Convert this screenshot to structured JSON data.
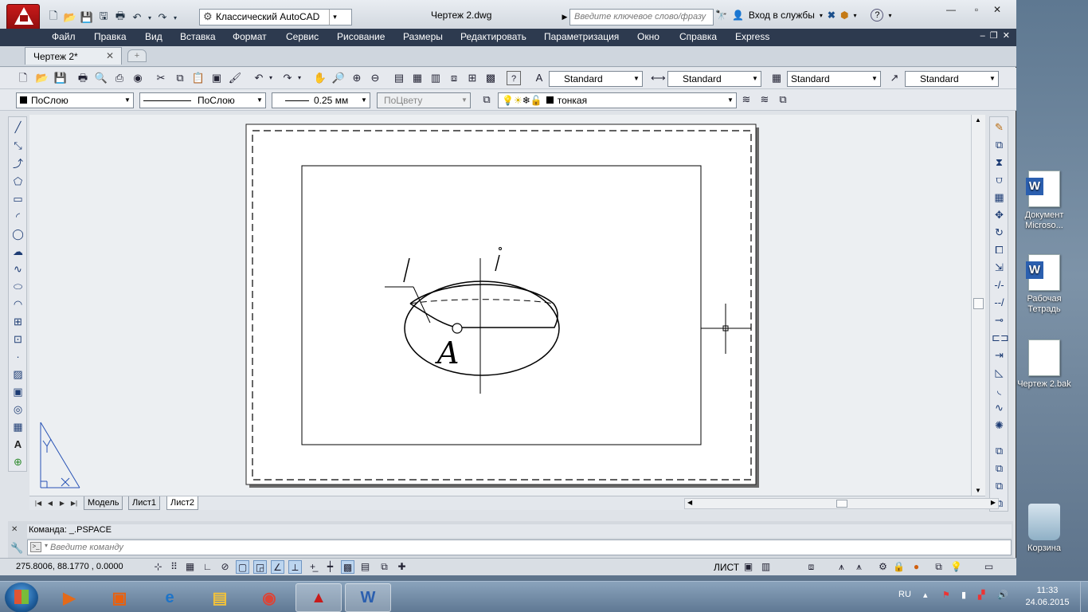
{
  "window": {
    "title": "Чертеж 2.dwg",
    "workspace": "Классический AutoCAD",
    "search_placeholder": "Введите ключевое слово/фразу",
    "signin": "Вход в службы",
    "help": "?",
    "minimize": "—",
    "restore": "▫",
    "close": "✕"
  },
  "menu": [
    "Файл",
    "Правка",
    "Вид",
    "Вставка",
    "Формат",
    "Сервис",
    "Рисование",
    "Размеры",
    "Редактировать",
    "Параметризация",
    "Окно",
    "Справка",
    "Express"
  ],
  "doc_tab": {
    "label": "Чертеж 2*",
    "close": "✕",
    "new": "+"
  },
  "styles": {
    "text_style": "Standard",
    "dim_style": "Standard",
    "table_style": "Standard",
    "mleader_style": "Standard"
  },
  "properties": {
    "color": "ПоСлою",
    "linetype": "ПоСлою",
    "lineweight": "0.25 мм",
    "plotstyle": "ПоЦвету",
    "layer": "тонкая"
  },
  "drawing": {
    "label_A": "A"
  },
  "layout_tabs": [
    "Модель",
    "Лист1",
    "Лист2"
  ],
  "active_layout": "Лист2",
  "command": {
    "history": "Команда:  _.PSPACE",
    "placeholder": "Введите  команду",
    "prompt_icon": ">_"
  },
  "status": {
    "coords": "275.8006,  88.1770  , 0.0000",
    "space": "ЛИСТ"
  },
  "desktop": [
    {
      "label": "Документ Microso..."
    },
    {
      "label": "Рабочая Тетрадь"
    },
    {
      "label": "Чертеж 2.bak"
    },
    {
      "label": "Корзина"
    }
  ],
  "tray": {
    "lang": "RU",
    "time": "11:33",
    "date": "24.06.2015"
  },
  "colors": {
    "menubar": "#2d3a4f",
    "title_bg": "#d2d8df",
    "accent": "#c81a1a",
    "taskbar": "#5f7893"
  }
}
